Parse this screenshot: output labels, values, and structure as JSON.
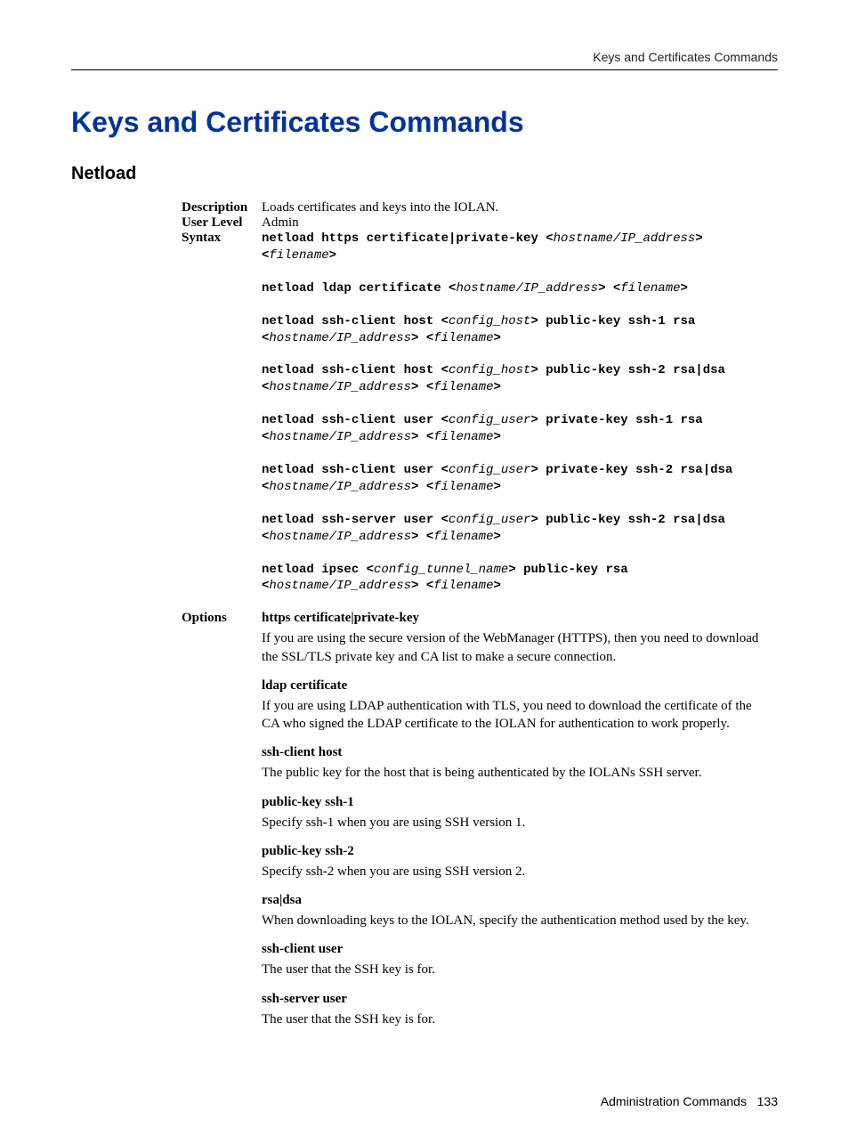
{
  "header": {
    "running": "Keys and Certificates Commands"
  },
  "h1": "Keys and Certificates Commands",
  "h2": "Netload",
  "labels": {
    "description": "Description",
    "userlevel": "User Level",
    "syntax": "Syntax",
    "options": "Options"
  },
  "values": {
    "description": "Loads certificates and keys into the IOLAN.",
    "userlevel": "Admin"
  },
  "syntax": [
    [
      {
        "b": "netload https certificate|private-key <"
      },
      {
        "v": "hostname/IP_address"
      },
      {
        "b": ">"
      },
      {
        "br": true
      },
      {
        "b": " <"
      },
      {
        "v": "filename"
      },
      {
        "b": ">"
      }
    ],
    [
      {
        "b": "netload ldap certificate <"
      },
      {
        "v": "hostname/IP_address"
      },
      {
        "b": "> <"
      },
      {
        "v": "filename"
      },
      {
        "b": ">"
      }
    ],
    [
      {
        "b": "netload ssh-client host <"
      },
      {
        "v": "config_host"
      },
      {
        "b": "> public-key ssh-1 rsa"
      },
      {
        "br": true
      },
      {
        "b": " <"
      },
      {
        "v": "hostname/IP_address"
      },
      {
        "b": "> <"
      },
      {
        "v": "filename"
      },
      {
        "b": ">"
      }
    ],
    [
      {
        "b": "netload ssh-client host <"
      },
      {
        "v": "config_host"
      },
      {
        "b": "> public-key ssh-2 rsa|dsa"
      },
      {
        "br": true
      },
      {
        "b": " <"
      },
      {
        "v": "hostname/IP_address"
      },
      {
        "b": "> <"
      },
      {
        "v": "filename"
      },
      {
        "b": ">"
      }
    ],
    [
      {
        "b": "netload ssh-client user <"
      },
      {
        "v": "config_user"
      },
      {
        "b": "> private-key ssh-1 rsa"
      },
      {
        "br": true
      },
      {
        "b": " <"
      },
      {
        "v": "hostname/IP_address"
      },
      {
        "b": "> <"
      },
      {
        "v": "filename"
      },
      {
        "b": ">"
      }
    ],
    [
      {
        "b": "netload ssh-client user <"
      },
      {
        "v": "config_user"
      },
      {
        "b": "> private-key ssh-2 rsa|dsa"
      },
      {
        "br": true
      },
      {
        "b": " <"
      },
      {
        "v": "hostname/IP_address"
      },
      {
        "b": "> <"
      },
      {
        "v": "filename"
      },
      {
        "b": ">"
      }
    ],
    [
      {
        "b": "netload ssh-server user <"
      },
      {
        "v": "config_user"
      },
      {
        "b": "> public-key ssh-2 rsa|dsa"
      },
      {
        "br": true
      },
      {
        "b": " <"
      },
      {
        "v": "hostname/IP_address"
      },
      {
        "b": "> <"
      },
      {
        "v": "filename"
      },
      {
        "b": ">"
      }
    ],
    [
      {
        "b": "netload ipsec <"
      },
      {
        "v": "config_tunnel_name"
      },
      {
        "b": "> public-key rsa"
      },
      {
        "br": true
      },
      {
        "b": " <"
      },
      {
        "v": "hostname/IP_address"
      },
      {
        "b": "> <"
      },
      {
        "v": "filename"
      },
      {
        "b": ">"
      }
    ]
  ],
  "options": [
    {
      "label": "https certificate|private-key",
      "body": "If you are using the secure version of the WebManager (HTTPS), then you need to download the SSL/TLS private key and CA list to make a secure connection."
    },
    {
      "label": "ldap certificate",
      "body": "If you are using LDAP authentication with TLS, you need to download the certificate of the CA who signed the LDAP certificate to the IOLAN for authentication to work properly."
    },
    {
      "label": "ssh-client host",
      "body": "The public key for the host that is being authenticated by the IOLANs SSH server."
    },
    {
      "label": "public-key ssh-1",
      "body": "Specify ssh-1 when you are using SSH version 1."
    },
    {
      "label": "public-key ssh-2",
      "body": "Specify ssh-2 when you are using SSH version 2."
    },
    {
      "label": "rsa|dsa",
      "body": "When downloading keys to the IOLAN, specify the authentication method used by the key."
    },
    {
      "label": "ssh-client user",
      "body": "The user that the SSH key is for."
    },
    {
      "label": "ssh-server user",
      "body": "The user that the SSH key is for."
    }
  ],
  "footer": {
    "section": "Administration Commands",
    "page": "133"
  }
}
